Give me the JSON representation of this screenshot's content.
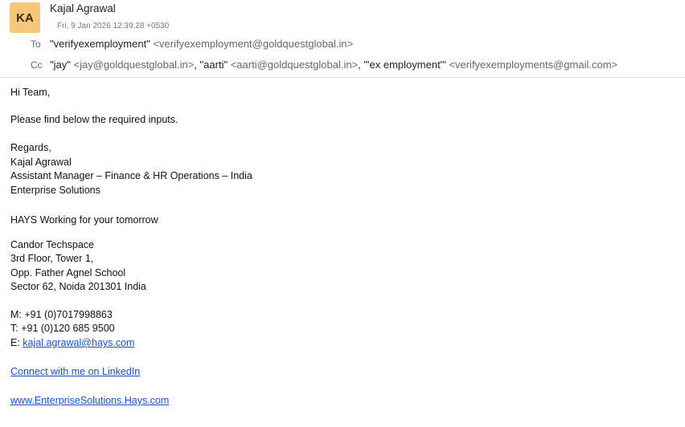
{
  "sender": {
    "initials": "KA",
    "name": "Kajal Agrawal",
    "avatar_color": "#f4c77a"
  },
  "sent_date": "Fri, 9 Jan 2026 12:39:28 +0530",
  "to": {
    "label": "To",
    "recipients": [
      {
        "name": "\"verifyexemployment\"",
        "address": "<verifyexemployment@goldquestglobal.in>"
      }
    ]
  },
  "cc": {
    "label": "Cc",
    "recipients": [
      {
        "name": "\"jay\"",
        "address": "<jay@goldquestglobal.in>",
        "sep": ","
      },
      {
        "name": "\"aarti\"",
        "address": "<aarti@goldquestglobal.in>",
        "sep": ","
      },
      {
        "name": "\"'ex employment'\"",
        "address": "<verifyexemployments@gmail.com>",
        "sep": ""
      }
    ]
  },
  "body": {
    "greeting": "Hi Team,",
    "message": "Please find below the required inputs.",
    "regards": "Regards,",
    "sig_name": "Kajal Agrawal",
    "sig_title": "Assistant Manager – Finance & HR Operations – India",
    "sig_dept": "Enterprise Solutions",
    "tagline": "HAYS Working for your tomorrow",
    "address": [
      "Candor Techspace",
      "3rd Floor, Tower 1,",
      "Opp. Father Agnel School",
      "Sector 62, Noida 201301 India"
    ],
    "mobile": "M: +91 (0)7017998863",
    "phone": "T: +91 (0)120 685 9500",
    "email_prefix": "E: ",
    "email_link": "kajal.agrawal@hays.com",
    "linkedin_link": "Connect with me on LinkedIn",
    "website_link": "www.EnterpriseSolutions.Hays.com"
  },
  "colors": {
    "link": "#1a4fd6",
    "label_gray": "#666666"
  }
}
